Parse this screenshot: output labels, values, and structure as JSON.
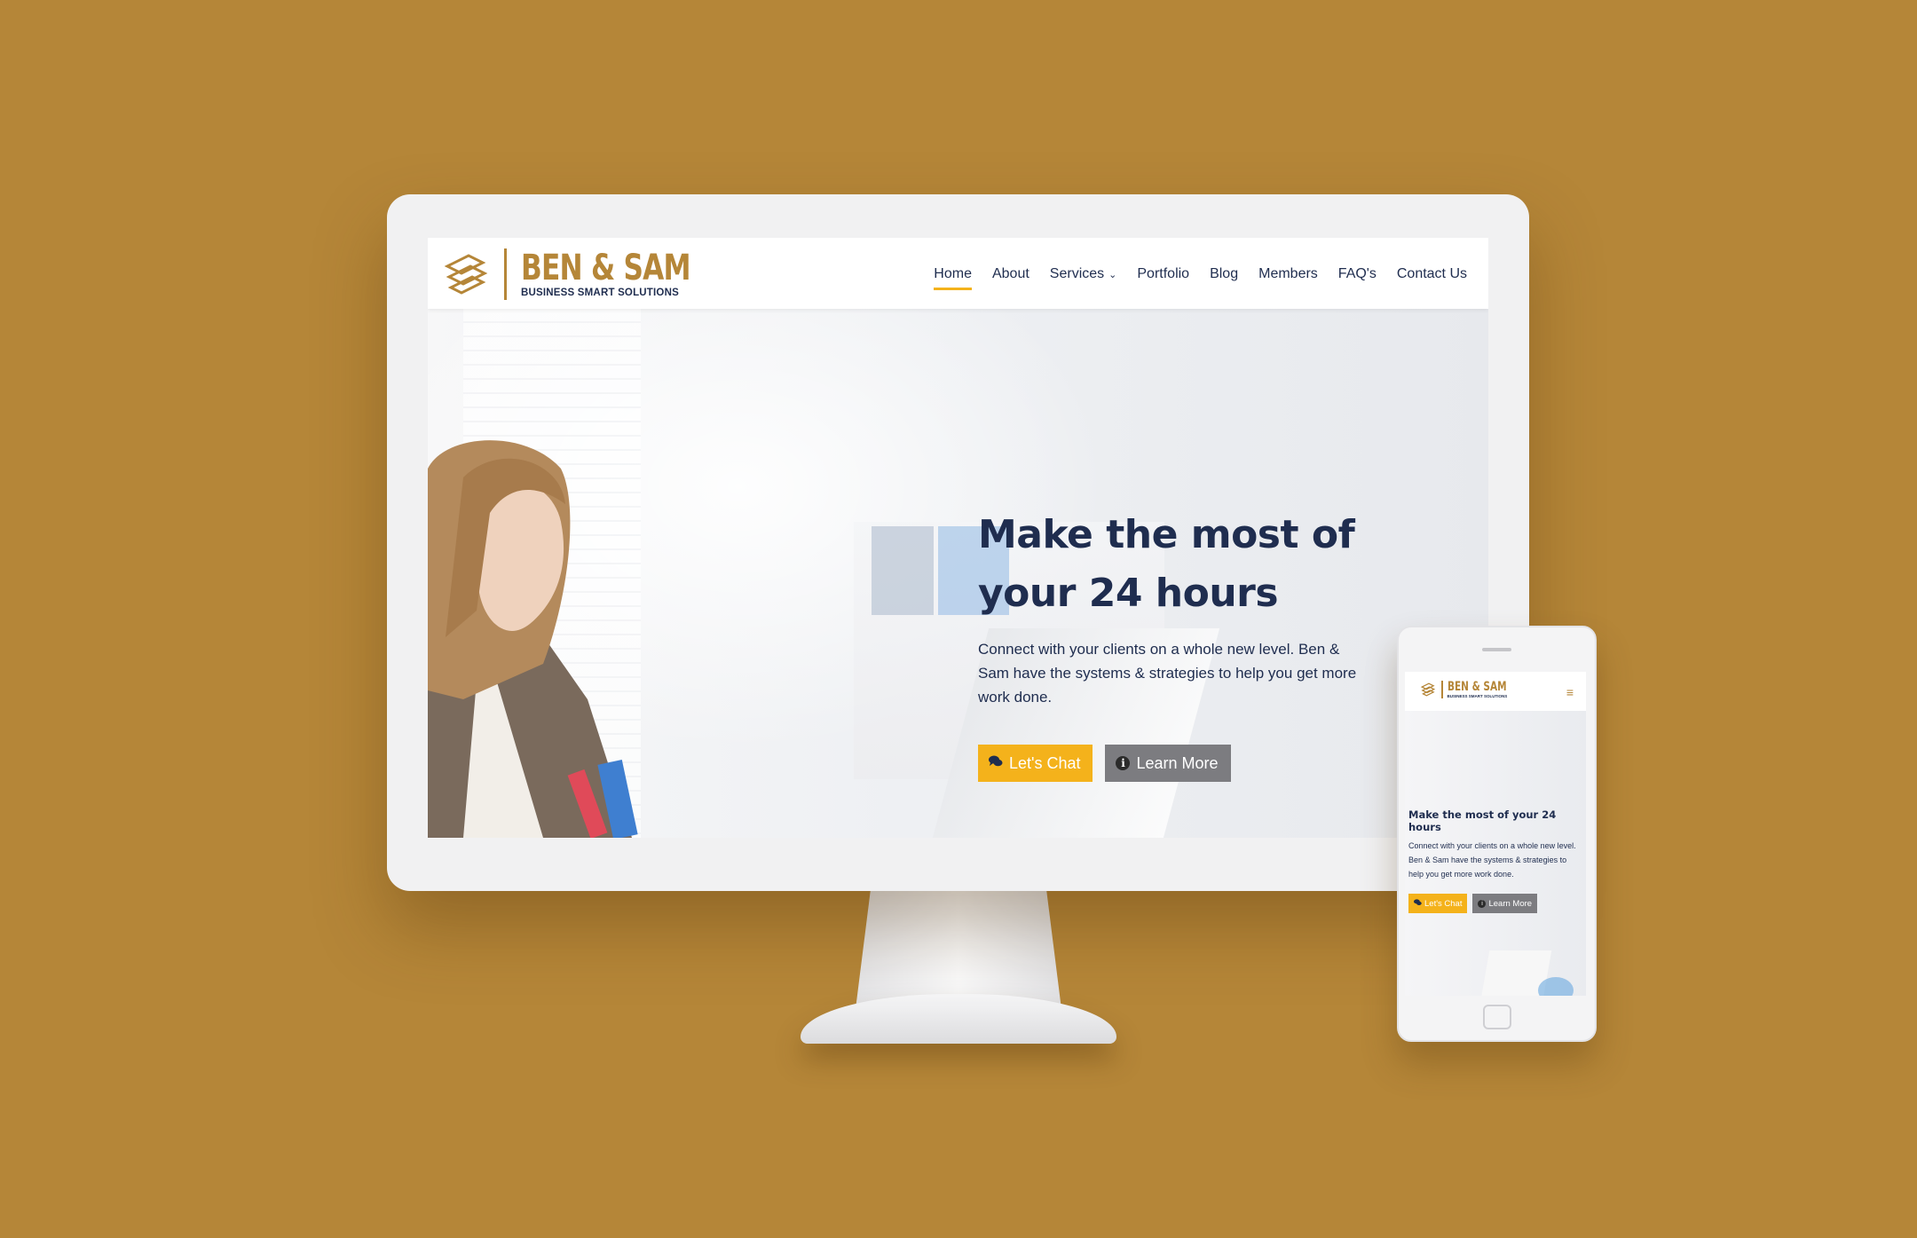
{
  "colors": {
    "background": "#b58638",
    "brand_gold": "#b58638",
    "accent_yellow": "#f4b21b",
    "navy": "#1f2d4f",
    "button_gray": "#7c7c80"
  },
  "brand": {
    "name": "BEN & SAM",
    "tagline": "BUSINESS SMART SOLUTIONS"
  },
  "nav": {
    "items": [
      {
        "label": "Home",
        "active": true
      },
      {
        "label": "About"
      },
      {
        "label": "Services",
        "has_dropdown": true
      },
      {
        "label": "Portfolio"
      },
      {
        "label": "Blog"
      },
      {
        "label": "Members"
      },
      {
        "label": "FAQ's"
      },
      {
        "label": "Contact Us"
      }
    ]
  },
  "hero": {
    "title_line1": "Make the most of",
    "title_line2": "your 24 hours",
    "subtitle": "Connect with your clients on a whole new level. Ben & Sam have the systems & strategies to help you get more work done.",
    "btn_chat": "Let's Chat",
    "btn_learn": "Learn More",
    "chat_icon": "chat-bubbles-icon",
    "learn_icon": "info-icon"
  },
  "mobile": {
    "title": "Make the most of your 24 hours",
    "subtitle": "Connect with your clients on a whole new level. Ben & Sam have the systems & strategies to help you get more work done.",
    "btn_chat": "Let's Chat",
    "btn_learn": "Learn More",
    "menu_icon": "hamburger-icon"
  }
}
